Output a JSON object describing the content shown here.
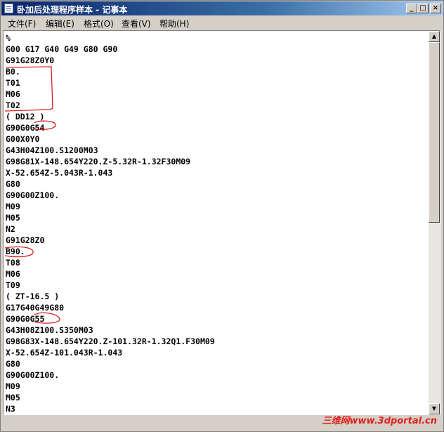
{
  "window": {
    "title": "卧加后处理程序样本 - 记事本",
    "controls": {
      "minimize": "_",
      "maximize": "□",
      "close": "×"
    }
  },
  "menu": {
    "items": [
      "文件(F)",
      "编辑(E)",
      "格式(O)",
      "查看(V)",
      "帮助(H)"
    ]
  },
  "editor": {
    "lines": [
      "%",
      "G00 G17 G40 G49 G80 G90",
      "G91G28Z0Y0",
      "B0.",
      "T01",
      "M06",
      "T02",
      "( DD12 )",
      "G90G0G54",
      "G00X0Y0",
      "G43H04Z100.S1200M03",
      "G98G81X-148.654Y220.Z-5.32R-1.32F30M09",
      "X-52.654Z-5.043R-1.043",
      "G80",
      "G90G00Z100.",
      "M09",
      "M05",
      "N2",
      "G91G28Z0",
      "B90.",
      "T08",
      "M06",
      "T09",
      "( ZT-16.5 )",
      "G17G40G49G80",
      "G90G0G55",
      "G43H08Z100.S350M03",
      "G98G83X-148.654Y220.Z-101.32R-1.32Q1.F30M09",
      "X-52.654Z-101.043R-1.043",
      "G80",
      "G90G00Z100.",
      "M09",
      "M05",
      "N3"
    ],
    "annotation_color": "#d81e1e"
  },
  "watermark": {
    "text": "三维网www.3dportal.cn"
  }
}
